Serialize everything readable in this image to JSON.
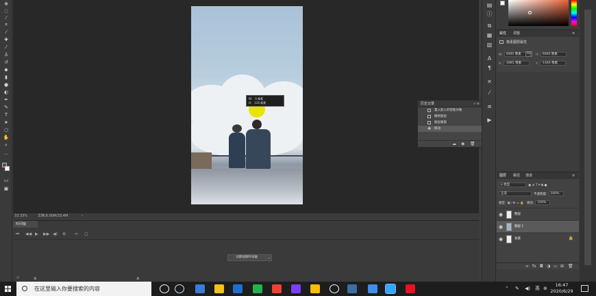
{
  "canvas": {
    "tooltip_line1": "W：  0 像素",
    "tooltip_line2": "H：  126 像素",
    "zoom": "33.33%",
    "doc_info": "文档:8.00M/33.4M"
  },
  "timeline": {
    "tab": "时间轴",
    "create_button": "创建视频时间轴"
  },
  "history": {
    "title": "历史记录",
    "items": [
      "置入嵌入的智能对象",
      "栅格图层",
      "图层蒙版",
      "移动"
    ],
    "active_index": 3
  },
  "properties": {
    "tabs": [
      "属性",
      "调整"
    ],
    "subtitle": "像素图层属性",
    "w_label": "W:",
    "w_value": "4000 像素",
    "h_label": "H:",
    "h_value": "6000 像素",
    "x_label": "X:",
    "x_value": "-2881 像素",
    "y_label": "Y:",
    "y_value": "-1444 像素",
    "link_icon": "GO"
  },
  "layers": {
    "tabs": [
      "图层",
      "路径",
      "通道"
    ],
    "filter": "ρ 类型",
    "blend_mode": "正常",
    "opacity_label": "不透明度:",
    "opacity_value": "100%",
    "lock_label": "锁定:",
    "fill_label": "填充:",
    "fill_value": "100%",
    "items": [
      {
        "name": "图层"
      },
      {
        "name": "图层 1"
      },
      {
        "name": "背景"
      }
    ],
    "selected_index": 1
  },
  "taskbar": {
    "search_placeholder": "在这里输入你要搜索的内容",
    "ime": "英",
    "time": "16:47",
    "date": "2020/6/29",
    "icon_colors": [
      "#ffffff",
      "#d1e7ff",
      "#3a7bd5",
      "#f0c419",
      "#1f6fd1",
      "#22b14c",
      "#ea4335",
      "#7e3ff2",
      "#fbbc05",
      "#ffffff",
      "#3b6ea5",
      "#3f8ee8",
      "#31a8ff",
      "#e81123"
    ]
  }
}
